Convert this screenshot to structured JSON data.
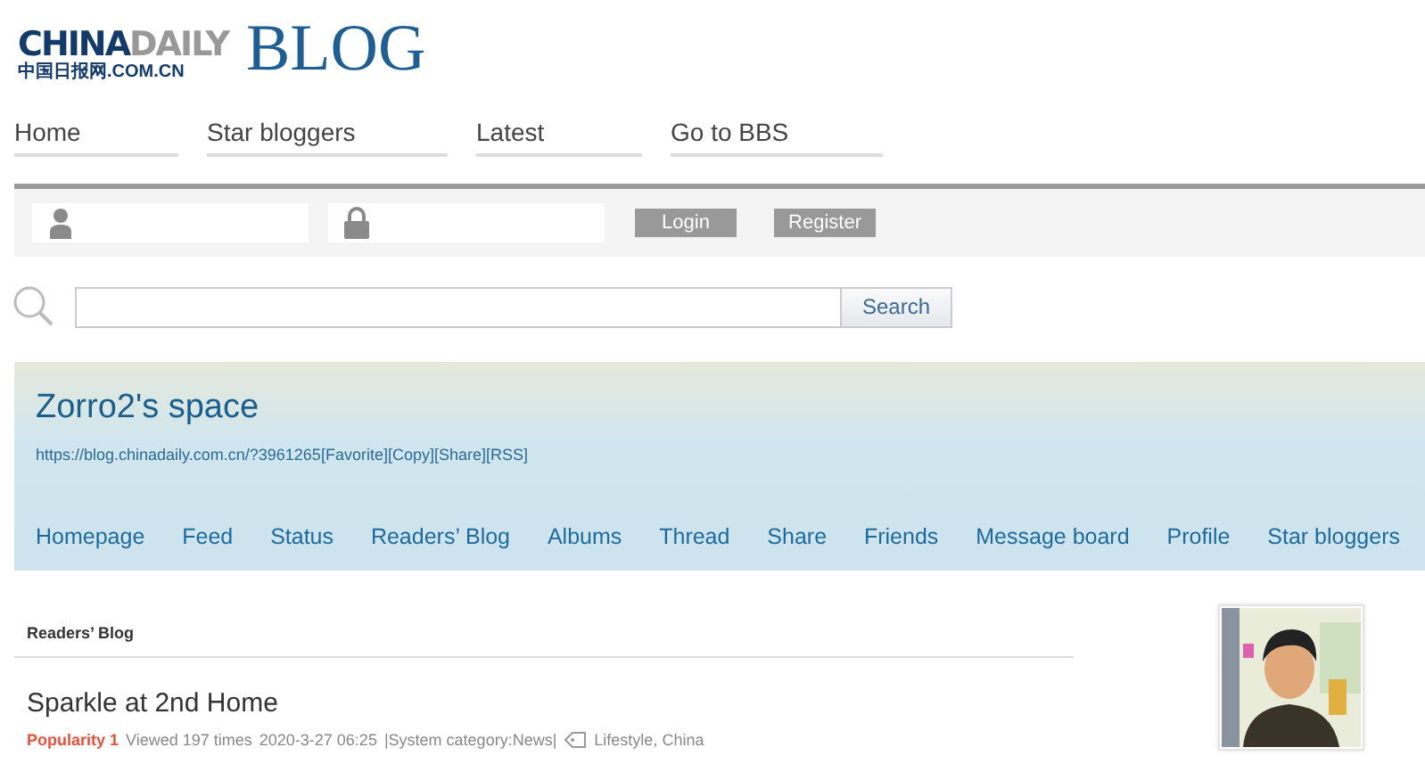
{
  "logo": {
    "brand_first": "CHINA",
    "brand_second": "DAILY",
    "brand_sub": "中国日报网.COM.CN",
    "product": "BLOG"
  },
  "top_nav": [
    {
      "label": "Home"
    },
    {
      "label": "Star bloggers"
    },
    {
      "label": "Latest"
    },
    {
      "label": "Go to BBS"
    }
  ],
  "login": {
    "buttons": [
      "Login",
      "Register"
    ]
  },
  "search": {
    "button": "Search"
  },
  "space": {
    "title": "Zorro2's space",
    "url": "https://blog.chinadaily.com.cn/?3961265",
    "links": [
      "[Favorite]",
      "[Copy]",
      "[Share]",
      "[RSS]"
    ],
    "tabs": [
      {
        "label": "Homepage"
      },
      {
        "label": "Feed"
      },
      {
        "label": "Status"
      },
      {
        "label": "Readers’ Blog"
      },
      {
        "label": "Albums"
      },
      {
        "label": "Thread"
      },
      {
        "label": "Share"
      },
      {
        "label": "Friends"
      },
      {
        "label": "Message board"
      },
      {
        "label": "Profile"
      },
      {
        "label": "Star bloggers"
      }
    ]
  },
  "section": {
    "heading": "Readers’ Blog"
  },
  "post": {
    "title": "Sparkle at 2nd Home",
    "popularity": "Popularity 1",
    "views": "Viewed 197 times",
    "date": "2020-3-27 06:25",
    "category": "|System category:News|",
    "tags": "Lifestyle, China"
  }
}
